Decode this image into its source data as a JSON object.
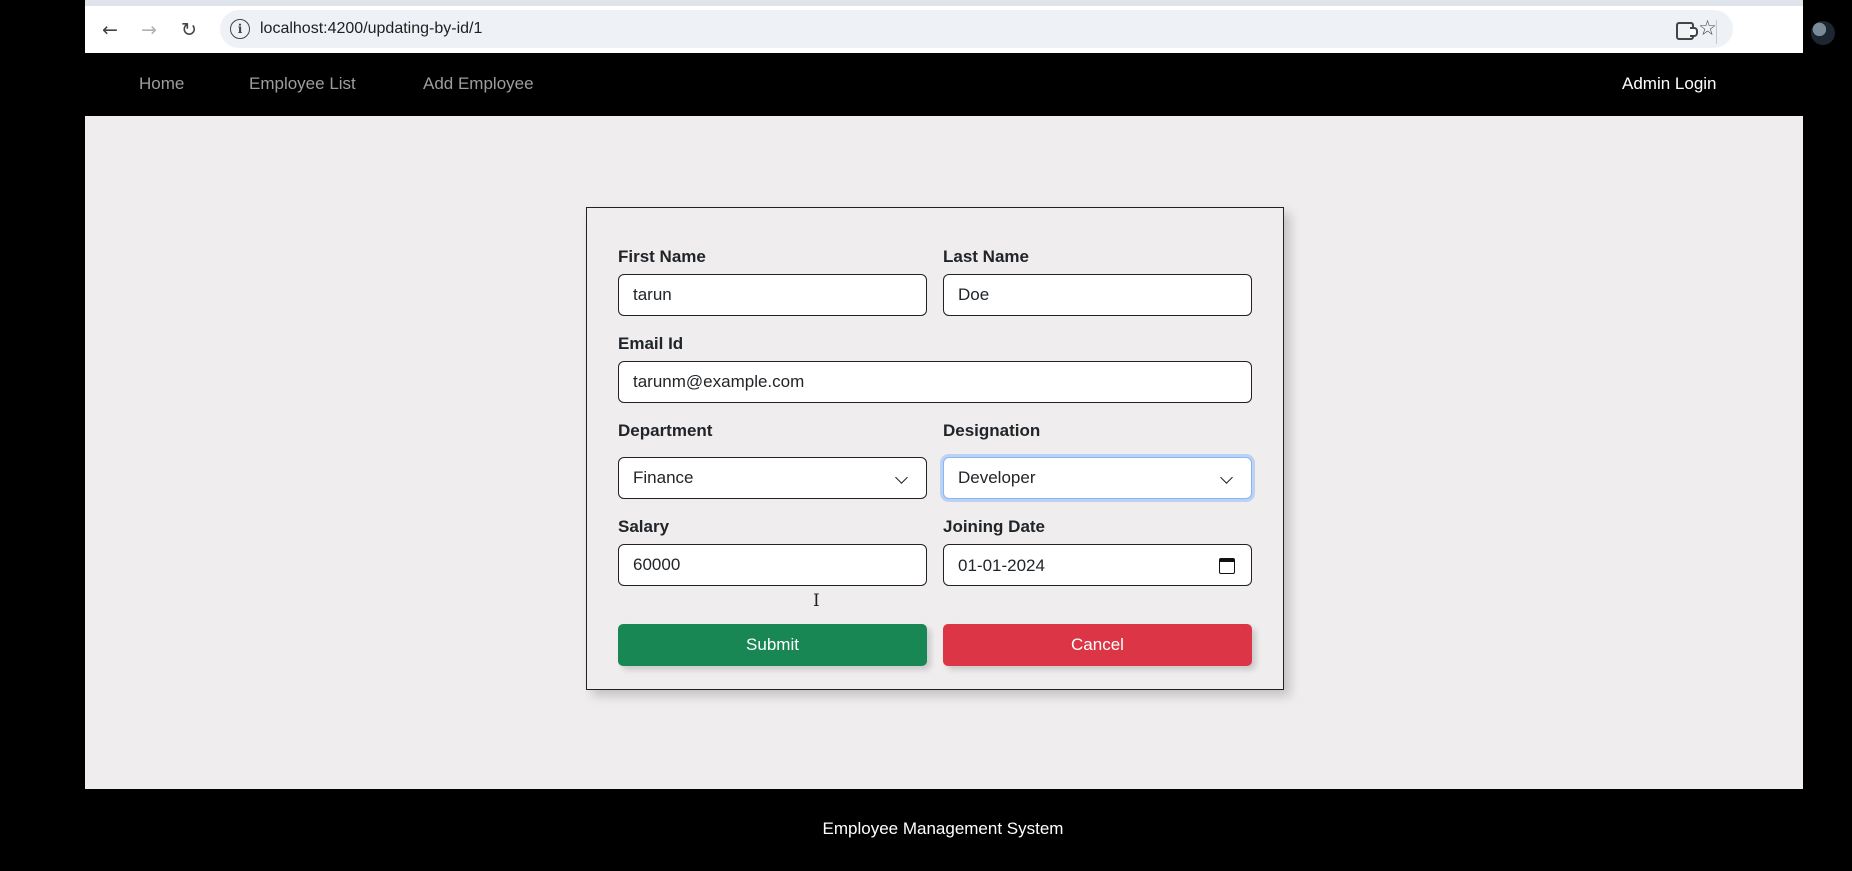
{
  "browser": {
    "url": "localhost:4200/updating-by-id/1",
    "back_icon": "←",
    "forward_icon": "→",
    "reload_icon": "↻",
    "bookmark_icon": "☆"
  },
  "navbar": {
    "home": "Home",
    "employee_list": "Employee List",
    "add_employee": "Add Employee",
    "admin_login": "Admin Login"
  },
  "form": {
    "first_name_label": "First Name",
    "first_name_value": "tarun",
    "last_name_label": "Last Name",
    "last_name_value": "Doe",
    "email_label": "Email Id",
    "email_value": "tarunm@example.com",
    "department_label": "Department",
    "department_value": "Finance",
    "designation_label": "Designation",
    "designation_value": "Developer",
    "salary_label": "Salary",
    "salary_value": "60000",
    "joining_date_label": "Joining Date",
    "joining_date_value": "01-01-2024",
    "submit_label": "Submit",
    "cancel_label": "Cancel"
  },
  "footer": {
    "text": "Employee Management System"
  },
  "colors": {
    "submit": "#198754",
    "cancel": "#dc3545",
    "page_background": "#efeded",
    "navbar": "#000000"
  }
}
